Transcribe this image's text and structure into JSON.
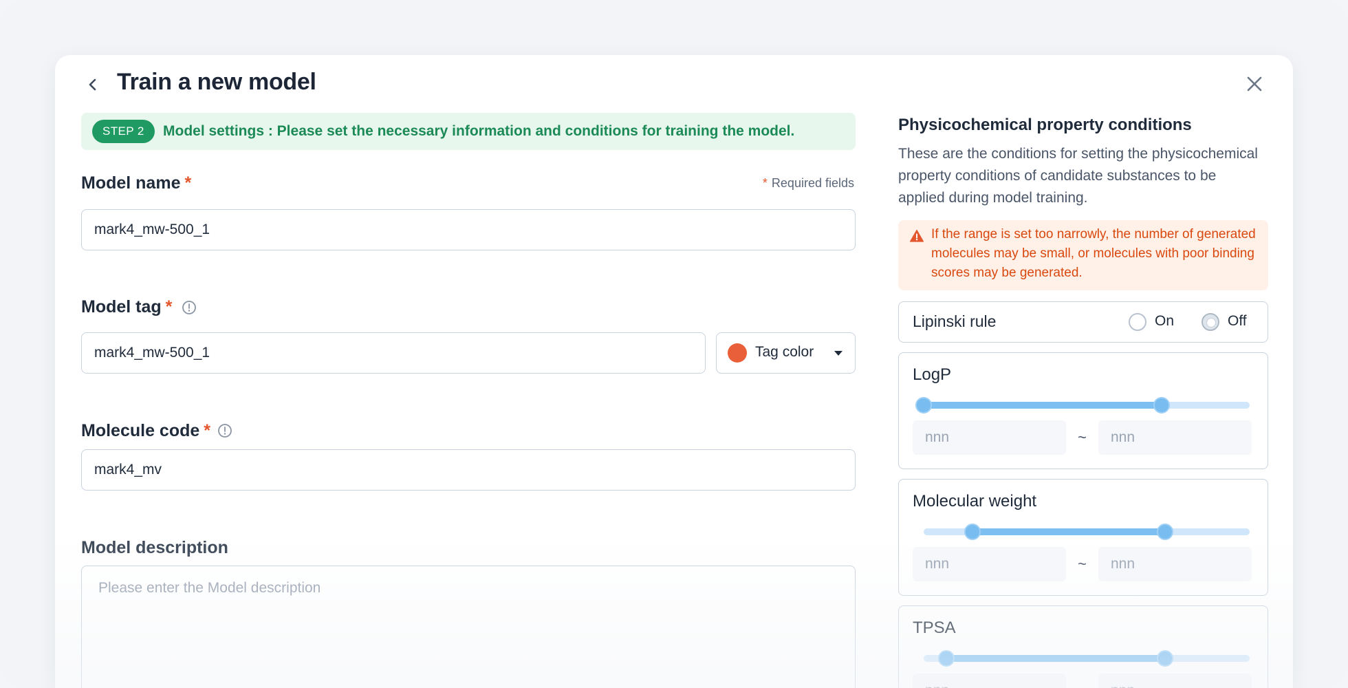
{
  "modal": {
    "title": "Train a new model"
  },
  "step": {
    "badge": "STEP 2",
    "text": "Model settings : Please set the necessary information and conditions for training the model."
  },
  "form": {
    "required_note": "Required fields",
    "required_star": "*",
    "model_name": {
      "label": "Model name",
      "value": "mark4_mw-500_1"
    },
    "model_tag": {
      "label": "Model tag",
      "value": "mark4_mw-500_1",
      "tag_color_label": "Tag color",
      "tag_color": "#e85f39"
    },
    "molecule_code": {
      "label": "Molecule code",
      "value": "mark4_mv"
    },
    "model_description": {
      "label": "Model description",
      "placeholder": "Please enter the Model description"
    }
  },
  "conditions": {
    "title": "Physicochemical property conditions",
    "description": "These are the conditions for setting the physicochemical property conditions of candidate substances to be applied during model training.",
    "warning": "If the range is set too narrowly, the number of generated molecules may be small, or molecules with poor binding scores may be generated.",
    "lipinski": {
      "label": "Lipinski rule",
      "on_label": "On",
      "off_label": "Off",
      "selected": "Off"
    },
    "tilde": "~",
    "ranges": [
      {
        "title": "LogP",
        "min_placeholder": "nnn",
        "max_placeholder": "nnn",
        "handle_min": 0.0,
        "handle_max": 0.73
      },
      {
        "title": "Molecular weight",
        "min_placeholder": "nnn",
        "max_placeholder": "nnn",
        "handle_min": 0.15,
        "handle_max": 0.74
      },
      {
        "title": "TPSA",
        "min_placeholder": "nnn",
        "max_placeholder": "nnn",
        "handle_min": 0.07,
        "handle_max": 0.74
      }
    ]
  },
  "colors": {
    "accent_green": "#1f9a62",
    "required_red": "#e4572e",
    "warning_orange": "#d9480f",
    "slider_blue": "#7dbff1"
  }
}
